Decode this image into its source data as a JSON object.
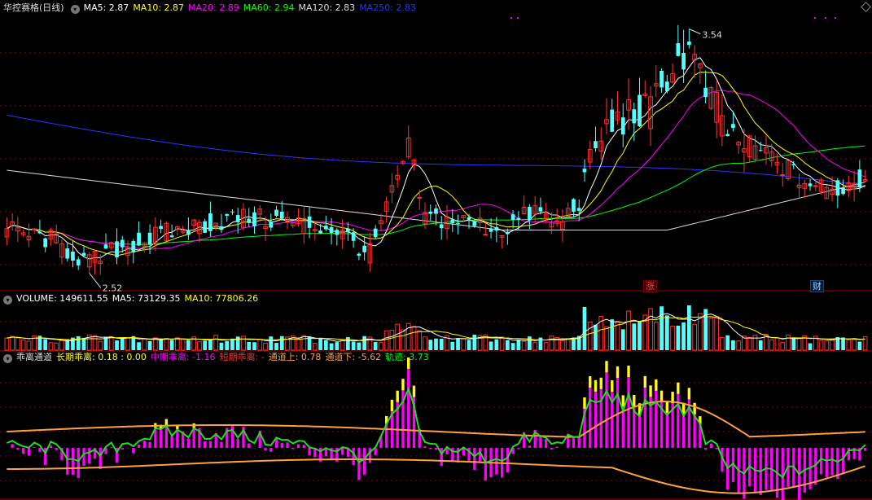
{
  "header": {
    "stock_title": "华控赛格(日线)",
    "ma_items": [
      {
        "label": "MA5: 2.87",
        "color": "#ffffff"
      },
      {
        "label": "MA10: 2.87",
        "color": "#ffff00"
      },
      {
        "label": "MA20: 2.89",
        "color": "#ff00ff"
      },
      {
        "label": "MA60: 2.94",
        "color": "#00ff00"
      },
      {
        "label": "MA120: 2.83",
        "color": "#dddddd"
      },
      {
        "label": "MA250: 2.83",
        "color": "#3030ff"
      }
    ]
  },
  "volume_header": {
    "items": [
      {
        "label": "VOLUME: 149611.55",
        "color": "#ffffff"
      },
      {
        "label": "MA5: 73129.35",
        "color": "#ffffff"
      },
      {
        "label": "MA10: 77806.26",
        "color": "#ffff00"
      }
    ]
  },
  "indicator_header": {
    "items": [
      {
        "label": "乖离通道",
        "color": "#dddddd"
      },
      {
        "label": "长期乖离: 0.18 : 0.00",
        "color": "#ffff00"
      },
      {
        "label": "中期乖离: -1.16",
        "color": "#ff00ff"
      },
      {
        "label": "短期乖离: -",
        "color": "#ff3333"
      },
      {
        "label": "通道上: 0.78",
        "color": "#ffa040"
      },
      {
        "label": "通道下: -5.62",
        "color": "#ffa040"
      },
      {
        "label": "轨迹: 3.73",
        "color": "#00ff00"
      }
    ]
  },
  "annotations": {
    "high_label": "3.54",
    "low_label": "2.52",
    "zhang_tag": "涨",
    "cai_tag": "财"
  },
  "colors": {
    "up": "#ff3232",
    "down": "#54ffff",
    "grid": "#8b0000",
    "ma5": "#ffffff",
    "ma10": "#ffff00",
    "ma20": "#ff00ff",
    "ma60": "#00ff00",
    "ma120": "#dddddd",
    "ma250": "#3030ff",
    "channel": "#ffa040",
    "track": "#22dd22"
  },
  "chart_data": {
    "type": "candlestick",
    "price_ylim": [
      2.45,
      3.6
    ],
    "high": 3.54,
    "low": 2.52,
    "num_bars": 157,
    "volume_ma5": 73129.35,
    "volume_ma10": 77806.26,
    "last_volume": 149611.55
  }
}
